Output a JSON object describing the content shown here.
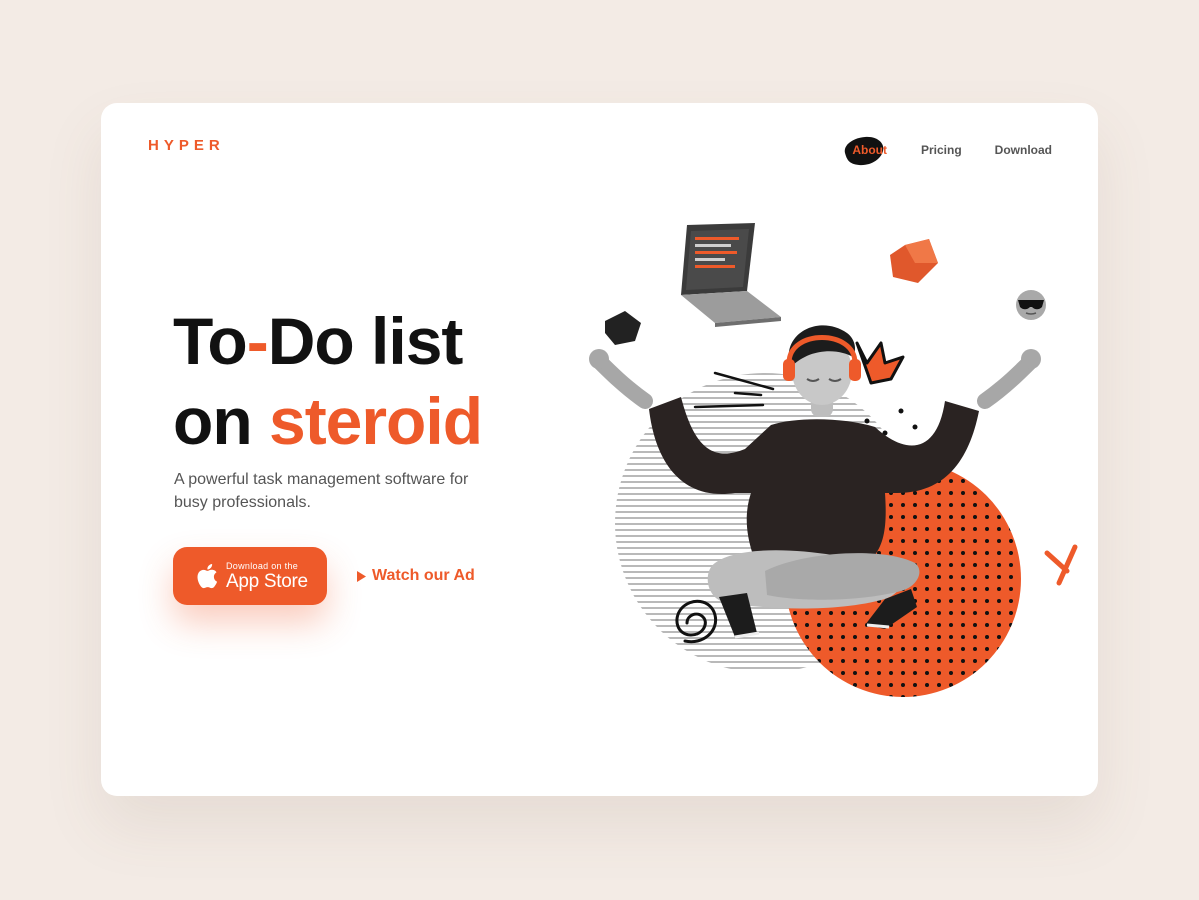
{
  "brand": {
    "logo": "HYPER",
    "accent_color": "#ee5a2a"
  },
  "nav": {
    "items": [
      {
        "label": "About",
        "active": true
      },
      {
        "label": "Pricing",
        "active": false
      },
      {
        "label": "Download",
        "active": false
      }
    ]
  },
  "hero": {
    "title_line1_part1": "To",
    "title_line1_dash": "-",
    "title_line1_part2": "Do list",
    "title_line2_part1": "on",
    "title_line2_accent": "steroid",
    "subtitle": "A powerful task management software for busy professionals."
  },
  "cta": {
    "store_small": "Download on the",
    "store_big": "App Store",
    "watch_label": "Watch our Ad",
    "store_icon": "apple-icon",
    "watch_icon": "play-icon"
  },
  "illustration": {
    "subject": "meditating-person-illustration",
    "items": [
      "laptop-icon",
      "cube-icon",
      "emoji-sunglasses-icon",
      "crown-doodle-icon",
      "cross-doodle-icon",
      "spiral-doodle-icon"
    ]
  }
}
